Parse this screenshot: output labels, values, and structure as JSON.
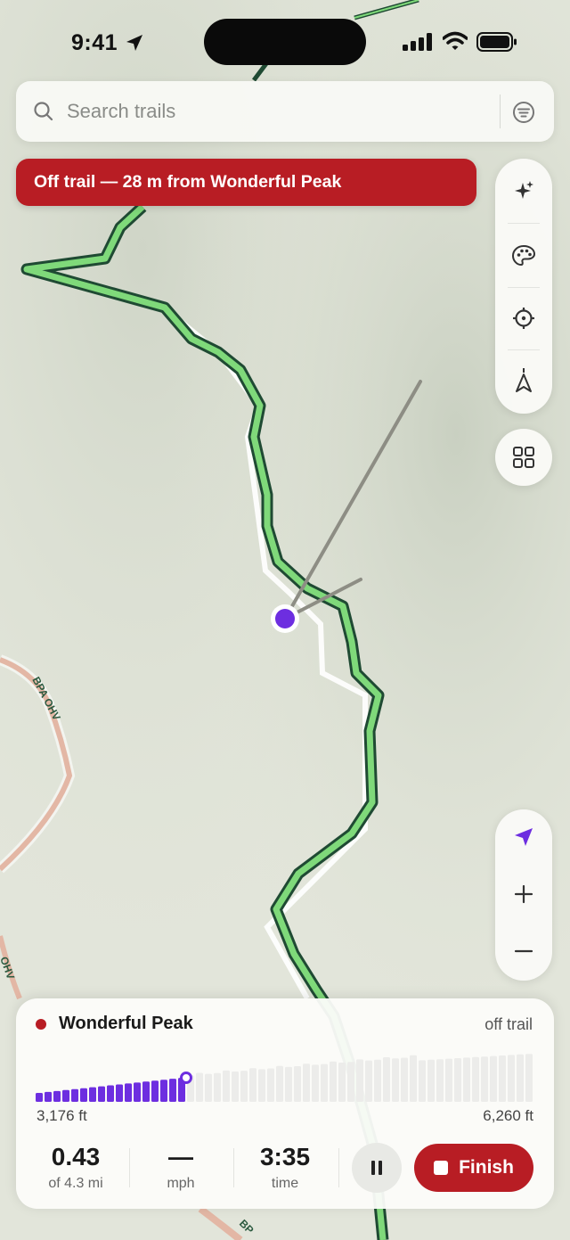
{
  "status_bar": {
    "time": "9:41"
  },
  "search": {
    "placeholder": "Search trails"
  },
  "alert_banner": {
    "text": "Off trail — 28 m from Wonderful Peak"
  },
  "map": {
    "road_labels": [
      "BPA OHV",
      "OHV",
      "BP"
    ]
  },
  "toolbar": {
    "icons": [
      "sparkles-icon",
      "palette-icon",
      "crosshair-icon",
      "compass-arrow-icon"
    ],
    "layers_icon": "grid-icon"
  },
  "zoom_controls": {
    "icons": [
      "location-arrow-icon",
      "plus-icon",
      "minus-icon"
    ]
  },
  "tracking_panel": {
    "trail_name": "Wonderful Peak",
    "status": "off trail",
    "elevation": {
      "low_label": "3,176 ft",
      "high_label": "6,260 ft",
      "progress_fraction": 0.3
    },
    "stats": [
      {
        "value": "0.43",
        "label": "of 4.3 mi"
      },
      {
        "value": "—",
        "label": "mph"
      },
      {
        "value": "3:35",
        "label": "time"
      }
    ],
    "finish_label": "Finish"
  },
  "colors": {
    "accent": "#6d2ee0",
    "alert": "#b81d24",
    "trail": "#7fd97a",
    "trail_outline": "#1f4a33"
  }
}
